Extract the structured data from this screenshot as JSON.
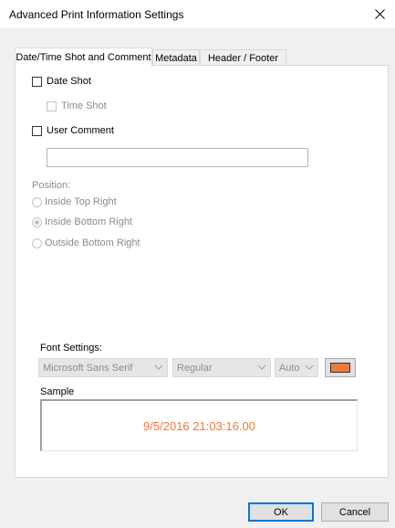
{
  "window": {
    "title": "Advanced Print Information Settings",
    "close_icon": "close-icon"
  },
  "tabs": [
    {
      "label": "Date/Time Shot and Comment",
      "active": true
    },
    {
      "label": "Metadata",
      "active": false
    },
    {
      "label": "Header / Footer",
      "active": false
    }
  ],
  "options": {
    "date_shot": {
      "label": "Date Shot",
      "checked": false,
      "enabled": true
    },
    "time_shot": {
      "label": "Time Shot",
      "checked": false,
      "enabled": false
    },
    "user_comment": {
      "label": "User Comment",
      "checked": false,
      "enabled": true
    },
    "comment_value": ""
  },
  "position": {
    "label": "Position:",
    "options": [
      {
        "label": "Inside Top Right",
        "selected": false
      },
      {
        "label": "Inside Bottom Right",
        "selected": true
      },
      {
        "label": "Outside Bottom Right",
        "selected": false
      }
    ]
  },
  "font_settings": {
    "label": "Font Settings:",
    "font_family": "Microsoft Sans Serif",
    "font_style": "Regular",
    "font_size": "Auto",
    "color": "#f07a3a",
    "icons": {
      "dropdown": "chevron-down-icon"
    }
  },
  "sample": {
    "label": "Sample",
    "text": "9/5/2016 21:03:16.00",
    "color": "#f07a3a"
  },
  "buttons": {
    "ok": "OK",
    "cancel": "Cancel"
  }
}
